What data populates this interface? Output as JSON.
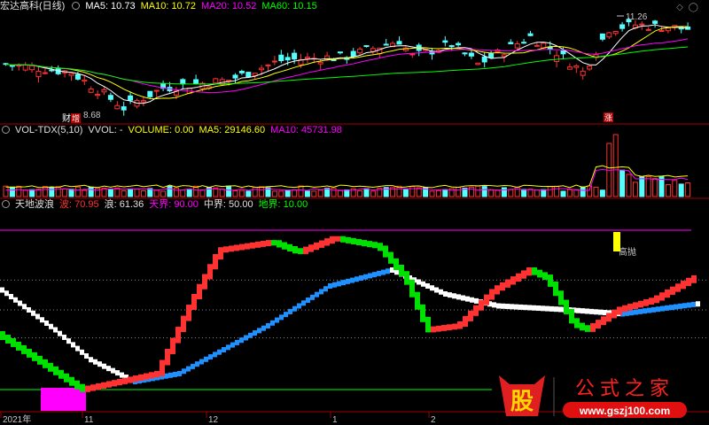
{
  "panel_price": {
    "title": "宏达高科(日线)",
    "ma5": "MA5: 10.73",
    "ma10": "MA10: 10.72",
    "ma20": "MA20: 10.52",
    "ma60": "MA60: 10.15",
    "high_label": "11.26",
    "low_label": "8.68",
    "badge_cai": "财",
    "badge_zeng": "增",
    "badge_zhang": "涨"
  },
  "panel_volume": {
    "title": "VOL-TDX(5,10)",
    "vvol": "VVOL: -",
    "volume": "VOLUME: 0.00",
    "ma5": "MA5: 29146.60",
    "ma10": "MA10: 45731.98"
  },
  "panel_indicator": {
    "title": "天地波浪",
    "bo": "波: 70.95",
    "lang": "浪: 61.36",
    "tianjie": "天界: 90.00",
    "zhongjie": "中界: 50.00",
    "dijie": "地界: 10.00",
    "signal": "高抛"
  },
  "time_axis": [
    "2021年",
    "11",
    "12",
    "1",
    "2"
  ],
  "icons": [
    "expand-icon",
    "circle-icon",
    "collapse-icon"
  ],
  "watermark": {
    "char": "股",
    "name": "公式之家",
    "url": "www.gszj100.com"
  },
  "colors": {
    "up": "#ff3232",
    "down": "#54ffff",
    "ma5": "#ffffff",
    "ma10": "#ffff00",
    "ma20": "#ff00ff",
    "ma60": "#00ff00",
    "wave_blue": "#1e90ff",
    "signal_yellow": "#ffff00",
    "magenta_block": "#ff00ff"
  },
  "chart_data": [
    {
      "type": "candlestick",
      "title": "宏达高科(日线)",
      "ma": {
        "MA5": 10.73,
        "MA10": 10.72,
        "MA20": 10.52,
        "MA60": 10.15
      },
      "annotations": {
        "high": 11.26,
        "low": 8.68
      },
      "y_range": [
        8.6,
        11.4
      ]
    },
    {
      "type": "bar",
      "title": "VOL-TDX(5,10)",
      "volume": 0.0,
      "ma5": 29146.6,
      "ma10": 45731.98
    },
    {
      "type": "line",
      "title": "天地波浪",
      "levels": {
        "天界": 90.0,
        "中界": 50.0,
        "地界": 10.0
      },
      "last": {
        "波": 70.95,
        "浪": 61.36
      },
      "y_range": [
        0,
        100
      ]
    }
  ]
}
